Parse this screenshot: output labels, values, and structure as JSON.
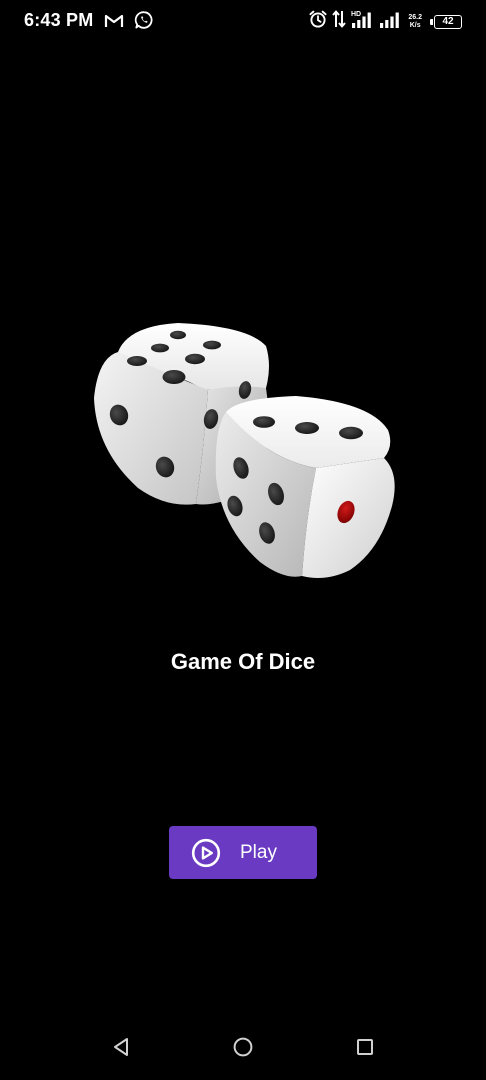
{
  "status_bar": {
    "time": "6:43 PM",
    "icons_left": [
      "gmail-icon",
      "whatsapp-icon"
    ],
    "icons_right": [
      "alarm-icon",
      "data-transfer-icon",
      "signal-hd-icon",
      "signal-icon"
    ],
    "net_speed_value": "26.2",
    "net_speed_unit": "K/s",
    "signal_hd_label": "HD",
    "battery_level": "42"
  },
  "main": {
    "illustration": "dice-pair",
    "title": "Game Of Dice",
    "play_button": {
      "label": "Play",
      "icon": "play-circle-icon",
      "color": "#6a3bc2"
    }
  },
  "nav_bar": {
    "buttons": [
      "back-icon",
      "home-icon",
      "recents-icon"
    ]
  }
}
